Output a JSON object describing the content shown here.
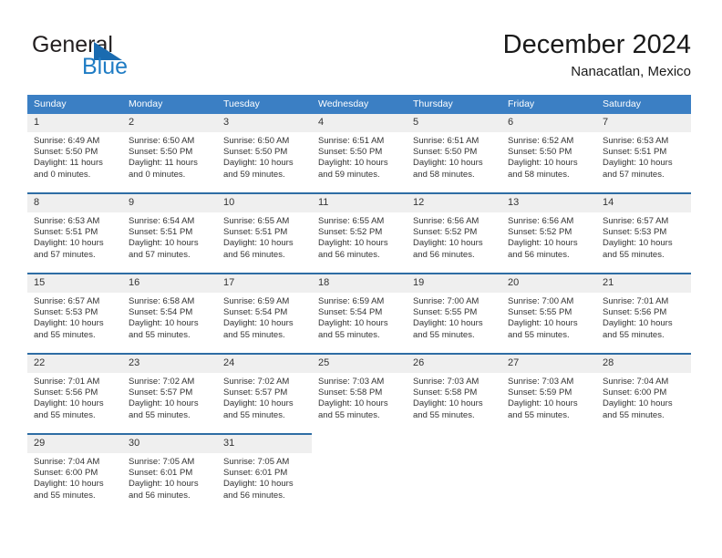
{
  "brand": {
    "name_part1": "General",
    "name_part2": "Blue",
    "accent_color": "#1f7cc4",
    "triangle_color": "#1a6bb0"
  },
  "header": {
    "title": "December 2024",
    "subtitle": "Nanacatlan, Mexico"
  },
  "calendar": {
    "header_bg": "#3b7fc4",
    "row_divider_color": "#2e6da4",
    "daynum_bg": "#efefef",
    "weekday_headers": [
      "Sunday",
      "Monday",
      "Tuesday",
      "Wednesday",
      "Thursday",
      "Friday",
      "Saturday"
    ],
    "weeks": [
      [
        {
          "day": "1",
          "sunrise": "Sunrise: 6:49 AM",
          "sunset": "Sunset: 5:50 PM",
          "daylight_line1": "Daylight: 11 hours",
          "daylight_line2": "and 0 minutes."
        },
        {
          "day": "2",
          "sunrise": "Sunrise: 6:50 AM",
          "sunset": "Sunset: 5:50 PM",
          "daylight_line1": "Daylight: 11 hours",
          "daylight_line2": "and 0 minutes."
        },
        {
          "day": "3",
          "sunrise": "Sunrise: 6:50 AM",
          "sunset": "Sunset: 5:50 PM",
          "daylight_line1": "Daylight: 10 hours",
          "daylight_line2": "and 59 minutes."
        },
        {
          "day": "4",
          "sunrise": "Sunrise: 6:51 AM",
          "sunset": "Sunset: 5:50 PM",
          "daylight_line1": "Daylight: 10 hours",
          "daylight_line2": "and 59 minutes."
        },
        {
          "day": "5",
          "sunrise": "Sunrise: 6:51 AM",
          "sunset": "Sunset: 5:50 PM",
          "daylight_line1": "Daylight: 10 hours",
          "daylight_line2": "and 58 minutes."
        },
        {
          "day": "6",
          "sunrise": "Sunrise: 6:52 AM",
          "sunset": "Sunset: 5:50 PM",
          "daylight_line1": "Daylight: 10 hours",
          "daylight_line2": "and 58 minutes."
        },
        {
          "day": "7",
          "sunrise": "Sunrise: 6:53 AM",
          "sunset": "Sunset: 5:51 PM",
          "daylight_line1": "Daylight: 10 hours",
          "daylight_line2": "and 57 minutes."
        }
      ],
      [
        {
          "day": "8",
          "sunrise": "Sunrise: 6:53 AM",
          "sunset": "Sunset: 5:51 PM",
          "daylight_line1": "Daylight: 10 hours",
          "daylight_line2": "and 57 minutes."
        },
        {
          "day": "9",
          "sunrise": "Sunrise: 6:54 AM",
          "sunset": "Sunset: 5:51 PM",
          "daylight_line1": "Daylight: 10 hours",
          "daylight_line2": "and 57 minutes."
        },
        {
          "day": "10",
          "sunrise": "Sunrise: 6:55 AM",
          "sunset": "Sunset: 5:51 PM",
          "daylight_line1": "Daylight: 10 hours",
          "daylight_line2": "and 56 minutes."
        },
        {
          "day": "11",
          "sunrise": "Sunrise: 6:55 AM",
          "sunset": "Sunset: 5:52 PM",
          "daylight_line1": "Daylight: 10 hours",
          "daylight_line2": "and 56 minutes."
        },
        {
          "day": "12",
          "sunrise": "Sunrise: 6:56 AM",
          "sunset": "Sunset: 5:52 PM",
          "daylight_line1": "Daylight: 10 hours",
          "daylight_line2": "and 56 minutes."
        },
        {
          "day": "13",
          "sunrise": "Sunrise: 6:56 AM",
          "sunset": "Sunset: 5:52 PM",
          "daylight_line1": "Daylight: 10 hours",
          "daylight_line2": "and 56 minutes."
        },
        {
          "day": "14",
          "sunrise": "Sunrise: 6:57 AM",
          "sunset": "Sunset: 5:53 PM",
          "daylight_line1": "Daylight: 10 hours",
          "daylight_line2": "and 55 minutes."
        }
      ],
      [
        {
          "day": "15",
          "sunrise": "Sunrise: 6:57 AM",
          "sunset": "Sunset: 5:53 PM",
          "daylight_line1": "Daylight: 10 hours",
          "daylight_line2": "and 55 minutes."
        },
        {
          "day": "16",
          "sunrise": "Sunrise: 6:58 AM",
          "sunset": "Sunset: 5:54 PM",
          "daylight_line1": "Daylight: 10 hours",
          "daylight_line2": "and 55 minutes."
        },
        {
          "day": "17",
          "sunrise": "Sunrise: 6:59 AM",
          "sunset": "Sunset: 5:54 PM",
          "daylight_line1": "Daylight: 10 hours",
          "daylight_line2": "and 55 minutes."
        },
        {
          "day": "18",
          "sunrise": "Sunrise: 6:59 AM",
          "sunset": "Sunset: 5:54 PM",
          "daylight_line1": "Daylight: 10 hours",
          "daylight_line2": "and 55 minutes."
        },
        {
          "day": "19",
          "sunrise": "Sunrise: 7:00 AM",
          "sunset": "Sunset: 5:55 PM",
          "daylight_line1": "Daylight: 10 hours",
          "daylight_line2": "and 55 minutes."
        },
        {
          "day": "20",
          "sunrise": "Sunrise: 7:00 AM",
          "sunset": "Sunset: 5:55 PM",
          "daylight_line1": "Daylight: 10 hours",
          "daylight_line2": "and 55 minutes."
        },
        {
          "day": "21",
          "sunrise": "Sunrise: 7:01 AM",
          "sunset": "Sunset: 5:56 PM",
          "daylight_line1": "Daylight: 10 hours",
          "daylight_line2": "and 55 minutes."
        }
      ],
      [
        {
          "day": "22",
          "sunrise": "Sunrise: 7:01 AM",
          "sunset": "Sunset: 5:56 PM",
          "daylight_line1": "Daylight: 10 hours",
          "daylight_line2": "and 55 minutes."
        },
        {
          "day": "23",
          "sunrise": "Sunrise: 7:02 AM",
          "sunset": "Sunset: 5:57 PM",
          "daylight_line1": "Daylight: 10 hours",
          "daylight_line2": "and 55 minutes."
        },
        {
          "day": "24",
          "sunrise": "Sunrise: 7:02 AM",
          "sunset": "Sunset: 5:57 PM",
          "daylight_line1": "Daylight: 10 hours",
          "daylight_line2": "and 55 minutes."
        },
        {
          "day": "25",
          "sunrise": "Sunrise: 7:03 AM",
          "sunset": "Sunset: 5:58 PM",
          "daylight_line1": "Daylight: 10 hours",
          "daylight_line2": "and 55 minutes."
        },
        {
          "day": "26",
          "sunrise": "Sunrise: 7:03 AM",
          "sunset": "Sunset: 5:58 PM",
          "daylight_line1": "Daylight: 10 hours",
          "daylight_line2": "and 55 minutes."
        },
        {
          "day": "27",
          "sunrise": "Sunrise: 7:03 AM",
          "sunset": "Sunset: 5:59 PM",
          "daylight_line1": "Daylight: 10 hours",
          "daylight_line2": "and 55 minutes."
        },
        {
          "day": "28",
          "sunrise": "Sunrise: 7:04 AM",
          "sunset": "Sunset: 6:00 PM",
          "daylight_line1": "Daylight: 10 hours",
          "daylight_line2": "and 55 minutes."
        }
      ],
      [
        {
          "day": "29",
          "sunrise": "Sunrise: 7:04 AM",
          "sunset": "Sunset: 6:00 PM",
          "daylight_line1": "Daylight: 10 hours",
          "daylight_line2": "and 55 minutes."
        },
        {
          "day": "30",
          "sunrise": "Sunrise: 7:05 AM",
          "sunset": "Sunset: 6:01 PM",
          "daylight_line1": "Daylight: 10 hours",
          "daylight_line2": "and 56 minutes."
        },
        {
          "day": "31",
          "sunrise": "Sunrise: 7:05 AM",
          "sunset": "Sunset: 6:01 PM",
          "daylight_line1": "Daylight: 10 hours",
          "daylight_line2": "and 56 minutes."
        },
        {
          "day": "",
          "sunrise": "",
          "sunset": "",
          "daylight_line1": "",
          "daylight_line2": ""
        },
        {
          "day": "",
          "sunrise": "",
          "sunset": "",
          "daylight_line1": "",
          "daylight_line2": ""
        },
        {
          "day": "",
          "sunrise": "",
          "sunset": "",
          "daylight_line1": "",
          "daylight_line2": ""
        },
        {
          "day": "",
          "sunrise": "",
          "sunset": "",
          "daylight_line1": "",
          "daylight_line2": ""
        }
      ]
    ]
  }
}
